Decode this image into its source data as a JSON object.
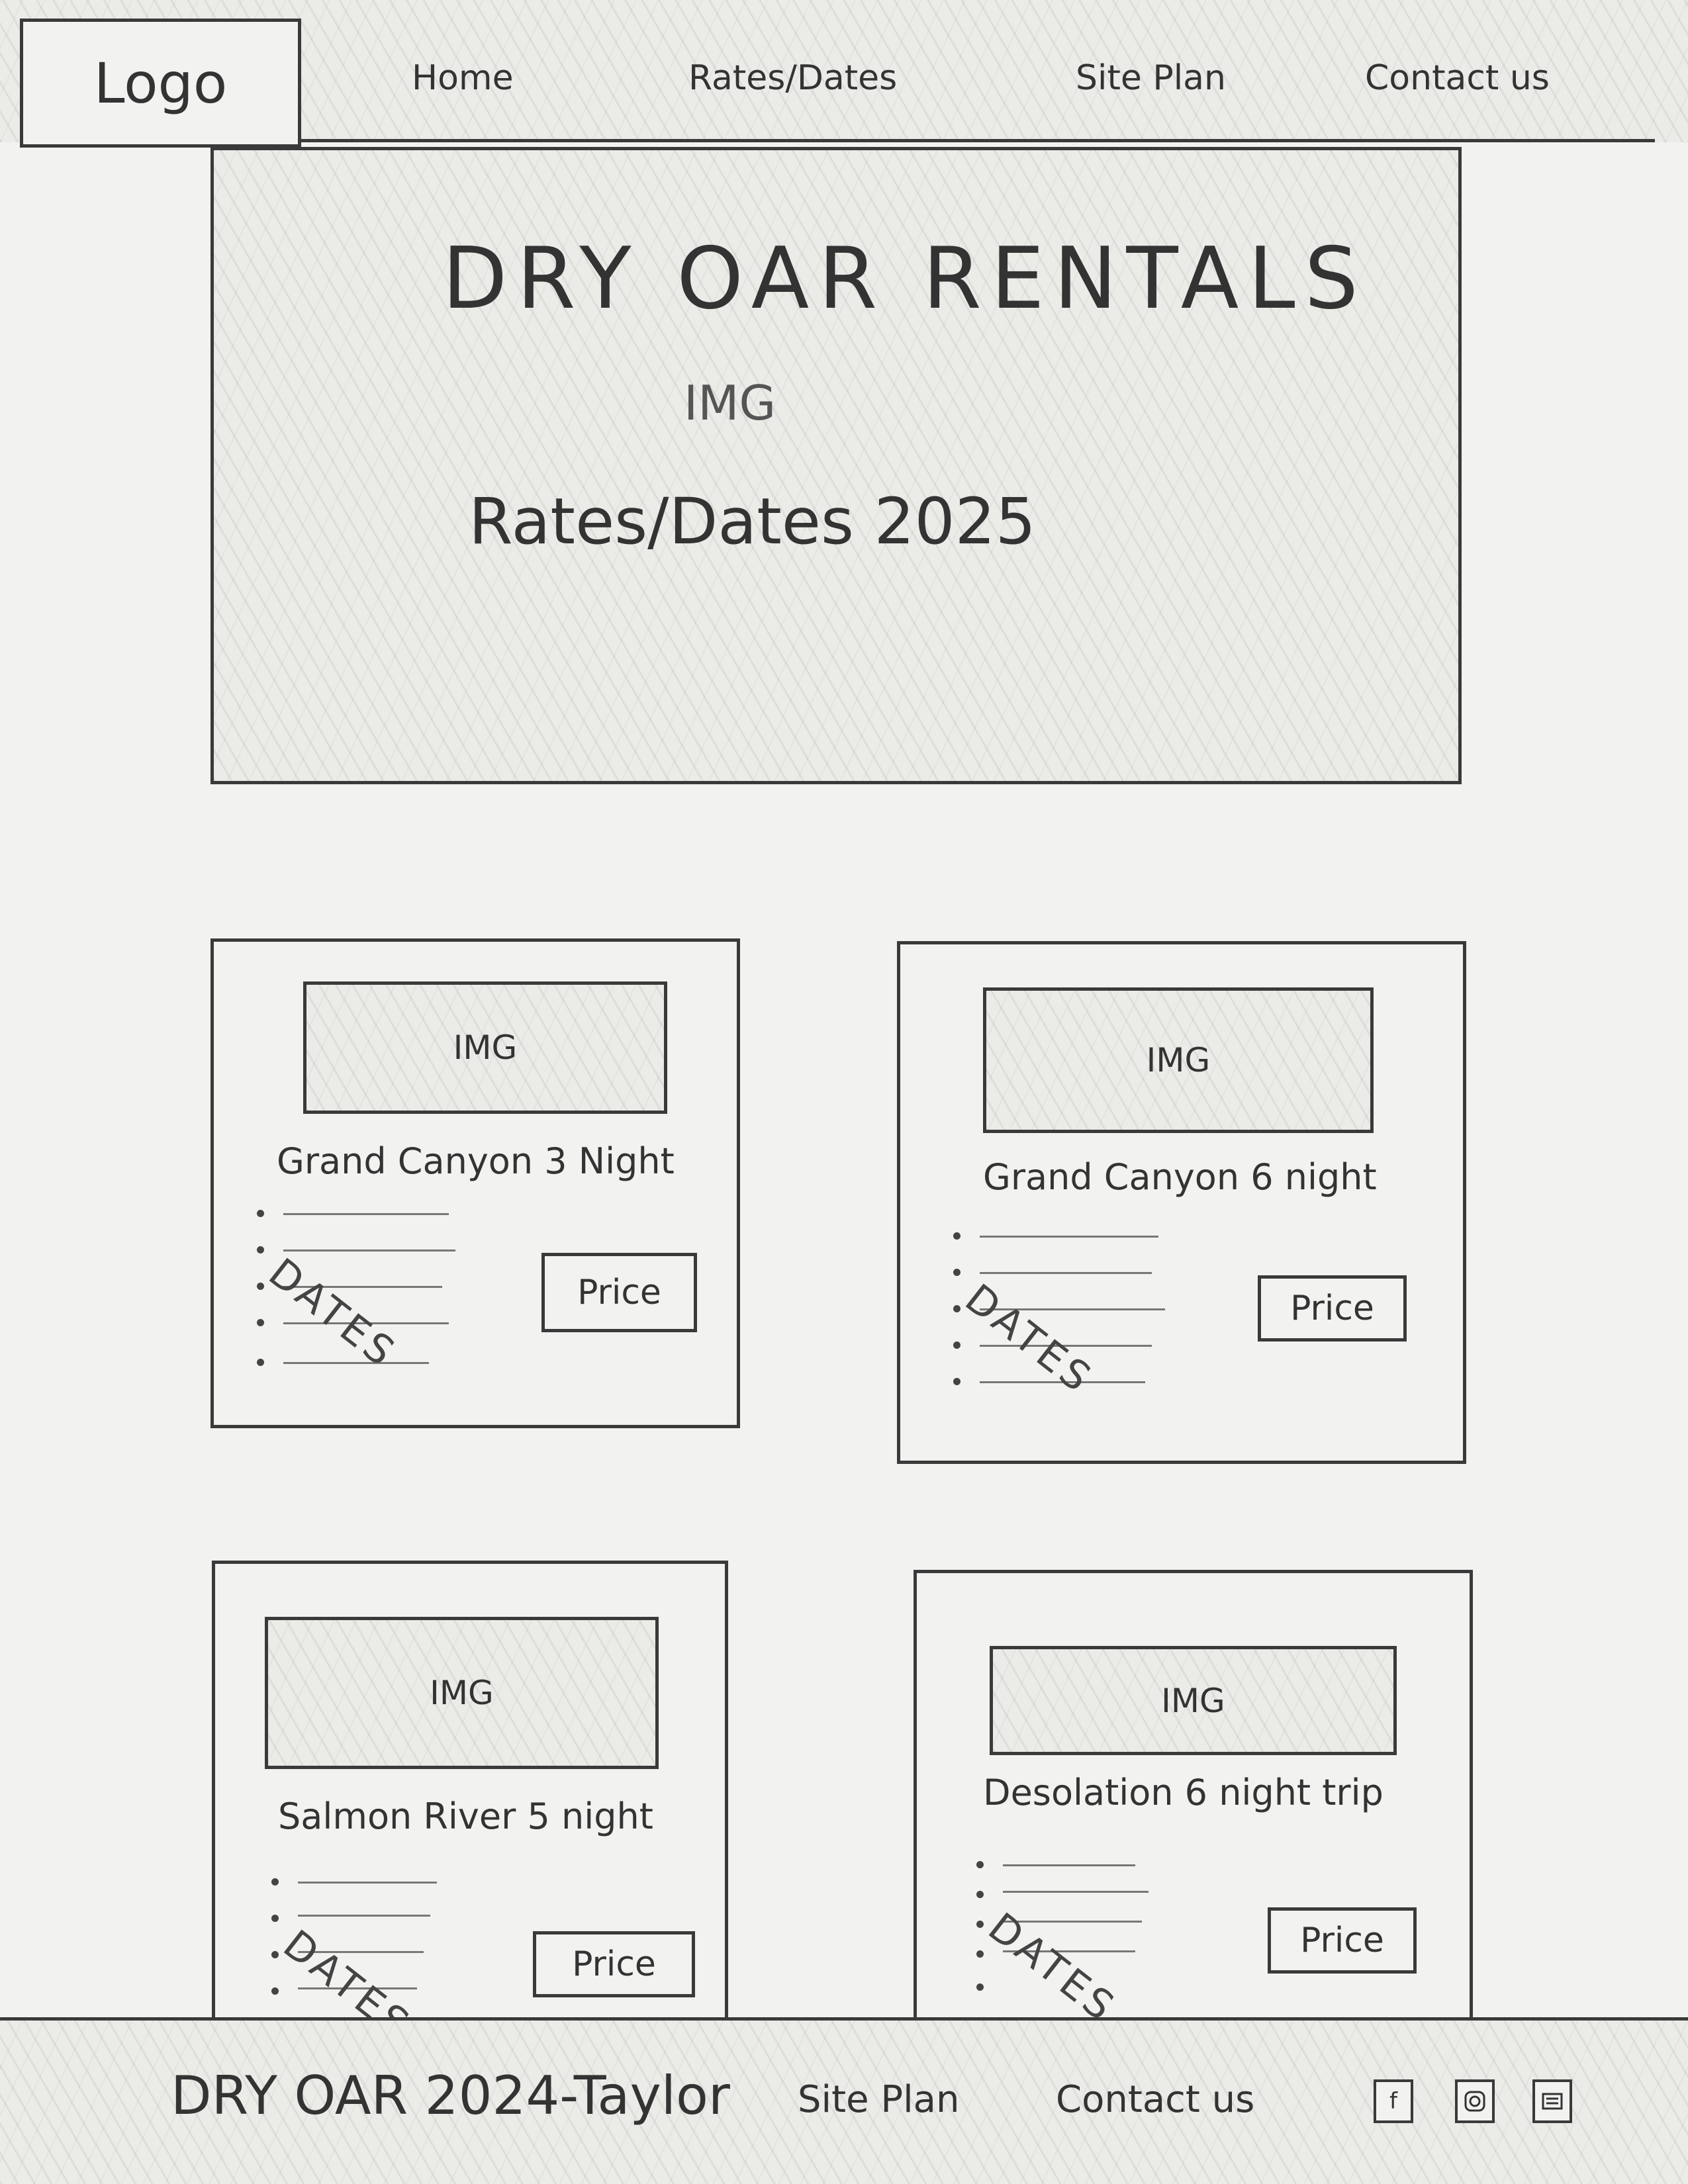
{
  "header": {
    "logo": "Logo",
    "nav": [
      "Home",
      "Rates/Dates",
      "Site Plan",
      "Contact us"
    ]
  },
  "hero": {
    "title": "DRY OAR RENTALS",
    "img_label": "IMG",
    "subtitle": "Rates/Dates 2025"
  },
  "cards": [
    {
      "img_label": "IMG",
      "title": "Grand Canyon 3 Night",
      "dates_label": "DATES",
      "price_label": "Price"
    },
    {
      "img_label": "IMG",
      "title": "Grand Canyon 6 night",
      "dates_label": "DATES",
      "price_label": "Price"
    },
    {
      "img_label": "IMG",
      "title": "Salmon River 5 night",
      "dates_label": "DATES",
      "price_label": "Price"
    },
    {
      "img_label": "IMG",
      "title": "Desolation 6 night trip",
      "dates_label": "DATES",
      "price_label": "Price"
    }
  ],
  "footer": {
    "brand": "DRY OAR 2024-Taylor",
    "links": [
      "Site Plan",
      "Contact us"
    ],
    "social_icons": [
      "facebook-icon",
      "instagram-icon",
      "mail-icon"
    ]
  }
}
